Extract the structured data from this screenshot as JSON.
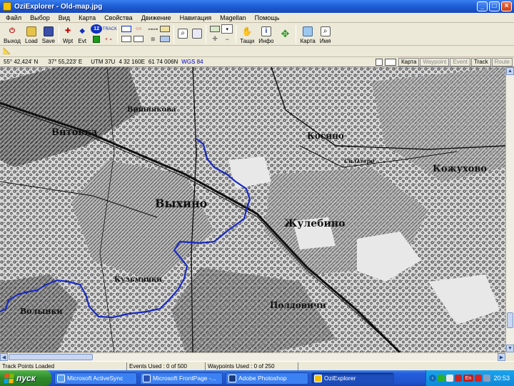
{
  "window": {
    "title": "OziExplorer - Old-map.jpg"
  },
  "menu": [
    "Файл",
    "Выбор",
    "Вид",
    "Карта",
    "Свойства",
    "Движение",
    "Навигация",
    "Magellan",
    "Помощь"
  ],
  "toolbar": {
    "exit": "Выход",
    "load": "Load",
    "save": "Save",
    "wpt": "Wpt",
    "evt": "Evt",
    "track": "+TRACK",
    "hands": "Тащи",
    "info": "Инфо",
    "map": "Карта",
    "name": "Имя"
  },
  "coords": {
    "lat": "55° 42,424' N",
    "lon": "37° 55,223' E",
    "utm": "UTM  37U",
    "easting": "4 32 160E",
    "northing": "61 74 006N",
    "datum": "WGS 84"
  },
  "tabs": [
    "Карта",
    "Waypoint",
    "Event",
    "Track",
    "Route"
  ],
  "map": {
    "labels": [
      "Вишнякова",
      "Витовка",
      "Выхино",
      "Жулебино",
      "Косино",
      "Кожухово",
      "Кузьминки",
      "Волынки",
      "Полдовичи",
      "Св.Озеро"
    ]
  },
  "status": {
    "track": "Track Points Loaded",
    "events": "Events Used :  0 of 500",
    "waypoints": "Waypoints Used :  0 of 250"
  },
  "taskbar": {
    "start": "пуск",
    "tasks": [
      "Microsoft ActiveSync",
      "Microsoft FrontPage -...",
      "Adobe Photoshop",
      "OziExplorer"
    ],
    "lang": "En",
    "clock": "20:53"
  },
  "colors": {
    "track": "#1a2bbf",
    "title_blue": "#1f5fd6",
    "start_green": "#2f8a2a"
  }
}
